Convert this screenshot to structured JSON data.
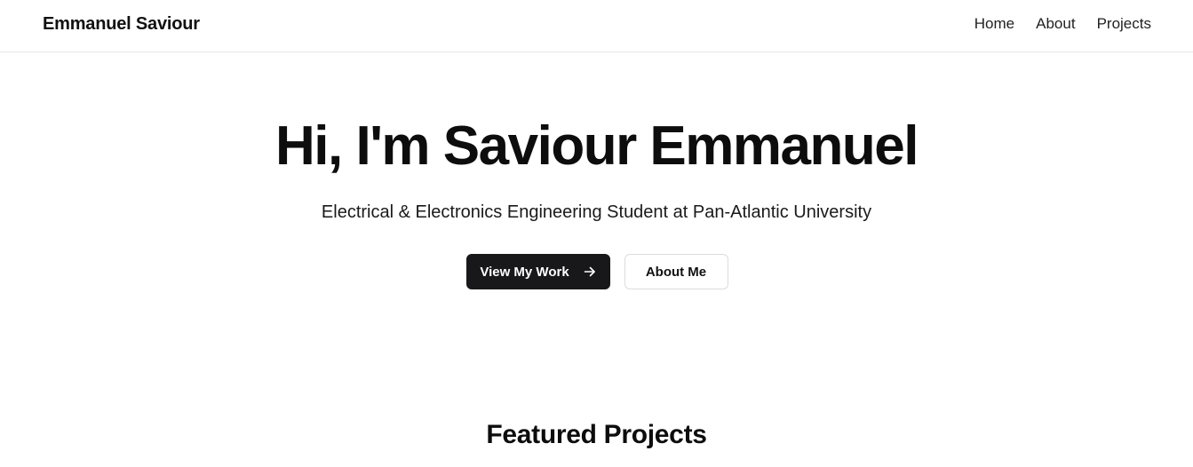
{
  "nav": {
    "brand": "Emmanuel Saviour",
    "links": [
      "Home",
      "About",
      "Projects"
    ]
  },
  "hero": {
    "title": "Hi, I'm Saviour Emmanuel",
    "subtitle": "Electrical & Electronics Engineering Student at Pan-Atlantic University",
    "primary_button": "View My Work",
    "primary_button_icon": "arrow-right-icon",
    "secondary_button": "About Me"
  },
  "featured": {
    "title": "Featured Projects"
  },
  "colors": {
    "primary_button_bg": "#18181b",
    "primary_button_text": "#ffffff",
    "text": "#111111",
    "border": "#e6e6e6"
  }
}
